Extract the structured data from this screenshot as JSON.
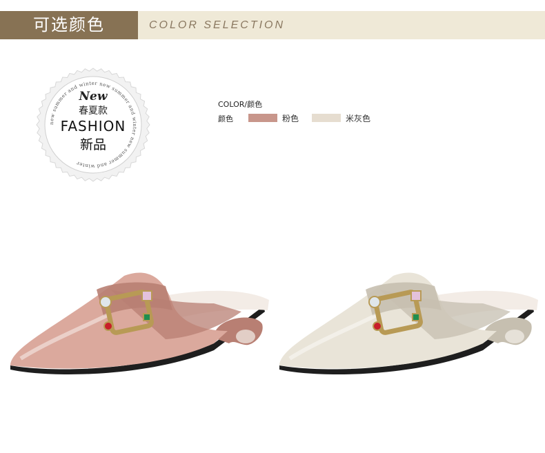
{
  "header": {
    "title_cn": "可选颜色",
    "title_en": "COLOR SELECTION"
  },
  "badge": {
    "new_label": "New",
    "season_label": "春夏款",
    "fashion_label": "FASHION",
    "new_product_label": "新品",
    "ring_text": "new summer and winter new summer and winter new summer and winter "
  },
  "color_selection": {
    "title": "COLOR/颜色",
    "row_label": "颜色",
    "options": [
      {
        "name": "粉色",
        "swatch": "#c8968b"
      },
      {
        "name": "米灰色",
        "swatch": "#e6ddd0"
      }
    ]
  },
  "products": [
    {
      "color_name": "粉色",
      "body_color": "#dba99d",
      "shade_color": "#b87f73",
      "icon": "pink-mule-shoe-icon"
    },
    {
      "color_name": "米灰色",
      "body_color": "#e9e4d8",
      "shade_color": "#c6bfb0",
      "icon": "beige-mule-shoe-icon"
    }
  ],
  "colors": {
    "header_bg": "#efe9d7",
    "header_tab": "#877254",
    "header_en_text": "#8a7860"
  }
}
